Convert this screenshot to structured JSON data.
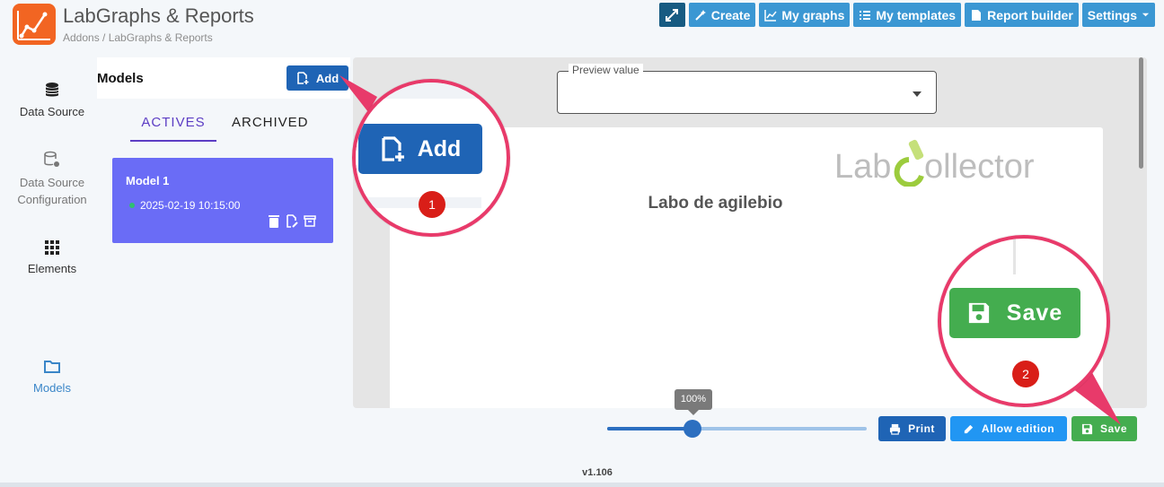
{
  "app": {
    "title": "LabGraphs & Reports",
    "breadcrumb": "Addons / LabGraphs & Reports"
  },
  "toolbar": {
    "create": "Create",
    "my_graphs": "My graphs",
    "my_templates": "My templates",
    "report_builder": "Report builder",
    "settings": "Settings"
  },
  "sidebar": {
    "items": [
      {
        "label": "Data Source",
        "icon": "database-icon"
      },
      {
        "label": "Data Source Configuration",
        "icon": "database-gear-icon"
      },
      {
        "label": "Elements",
        "icon": "grid-icon"
      },
      {
        "label": "Models",
        "icon": "folder-icon"
      }
    ]
  },
  "models": {
    "title": "Models",
    "add_label": "Add",
    "tabs": [
      "ACTIVES",
      "ARCHIVED"
    ],
    "card": {
      "name": "Model 1",
      "date": "2025-02-19 10:15:00"
    }
  },
  "preview": {
    "label": "Preview value",
    "report_title": "Labo de agilebio",
    "logo_text": "LabCollector"
  },
  "zoom": {
    "value": 0.33,
    "label": "100%"
  },
  "actions": {
    "print": "Print",
    "allow_edition": "Allow edition",
    "save": "Save"
  },
  "callouts": {
    "one": {
      "number": "1",
      "label": "Add"
    },
    "two": {
      "number": "2",
      "label": "Save"
    }
  },
  "footer": {
    "version": "v1.106"
  },
  "colors": {
    "brand_orange": "#f26522",
    "primary_blue": "#1f64b5",
    "card_purple": "#6a6cf6",
    "save_green": "#44ad4f",
    "callout_pink": "#e83a6a"
  }
}
